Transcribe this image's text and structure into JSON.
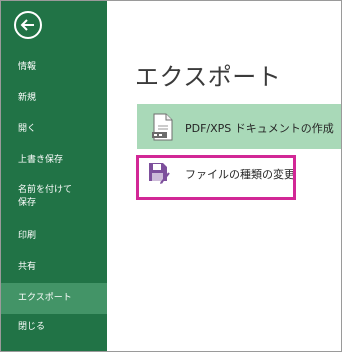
{
  "sidebar": {
    "back_icon": "back-arrow-icon",
    "items": [
      {
        "label": "情報"
      },
      {
        "label": "新規"
      },
      {
        "label": "開く"
      },
      {
        "label": "上書き保存"
      },
      {
        "label": "名前を付けて"
      },
      {
        "label": "保存"
      },
      {
        "label": "印刷"
      },
      {
        "label": "共有"
      },
      {
        "label": "エクスポート",
        "selected": true
      },
      {
        "label": "閉じる"
      }
    ]
  },
  "main": {
    "title": "エクスポート",
    "options": [
      {
        "label": "PDF/XPS ドキュメントの作成",
        "icon": "pdf-document-icon",
        "selected": true
      },
      {
        "label": "ファイルの種類の変更",
        "icon": "save-as-file-type-icon",
        "highlighted": true
      }
    ]
  },
  "colors": {
    "sidebar": "#217346",
    "sidebar_selected": "#439467",
    "option_selected": "#a9d9b8",
    "highlight_border": "#d22796"
  }
}
